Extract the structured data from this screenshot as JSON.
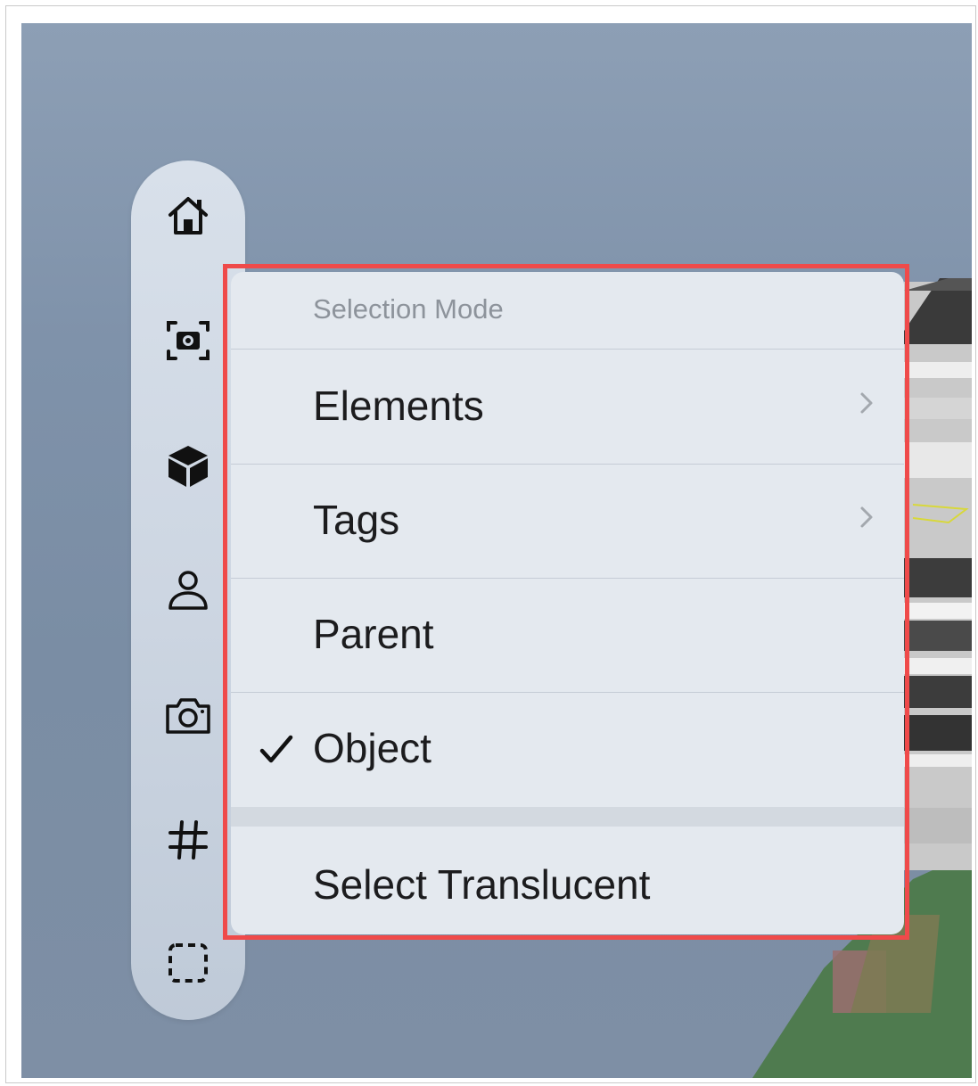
{
  "toolbar": {
    "items": [
      {
        "icon": "home-icon"
      },
      {
        "icon": "capture-icon"
      },
      {
        "icon": "cube-icon"
      },
      {
        "icon": "person-icon"
      },
      {
        "icon": "camera-icon"
      },
      {
        "icon": "grid-icon"
      },
      {
        "icon": "selection-box-icon"
      }
    ]
  },
  "menu": {
    "header": "Selection Mode",
    "items": [
      {
        "label": "Elements",
        "has_submenu": true,
        "checked": false
      },
      {
        "label": "Tags",
        "has_submenu": true,
        "checked": false
      },
      {
        "label": "Parent",
        "has_submenu": false,
        "checked": false
      },
      {
        "label": "Object",
        "has_submenu": false,
        "checked": true
      }
    ],
    "footer_item": {
      "label": "Select Translucent"
    }
  },
  "colors": {
    "highlight": "#ef4a4a",
    "menu_bg": "#e4e9ef",
    "toolbar_bg": "#cdd6e2",
    "sky": "#7f92aa",
    "ground": "#4e7a4e"
  }
}
